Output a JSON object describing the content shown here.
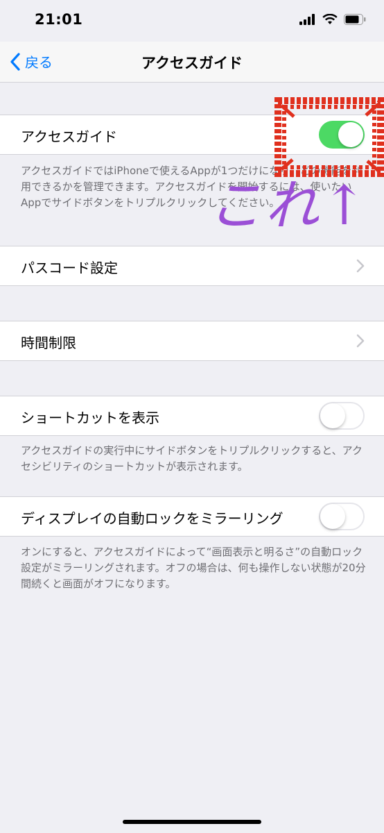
{
  "status_bar": {
    "time": "21:01"
  },
  "nav": {
    "back_label": "戻る",
    "title": "アクセスガイド"
  },
  "guided_access": {
    "label": "アクセスガイド",
    "toggle_on": true,
    "footer": "アクセスガイドではiPhoneで使えるAppが1つだけになり、どの機能を利用できるかを管理できます。アクセスガイドを開始するには、使いたいAppでサイドボタンをトリプルクリックしてください。"
  },
  "passcode": {
    "label": "パスコード設定"
  },
  "time_limits": {
    "label": "時間制限"
  },
  "shortcut": {
    "label": "ショートカットを表示",
    "toggle_on": false,
    "footer": "アクセスガイドの実行中にサイドボタンをトリプルクリックすると、アクセシビリティのショートカットが表示されます。"
  },
  "mirror_lock": {
    "label": "ディスプレイの自動ロックをミラーリング",
    "toggle_on": false,
    "footer": "オンにすると、アクセスガイドによって“画面表示と明るさ”の自動ロック設定がミラーリングされます。オフの場合は、何も操作しない状態が20分間続くと画面がオフになります。"
  },
  "annotation": {
    "text": "これ↑"
  },
  "colors": {
    "accent": "#007aff",
    "toggle_on": "#4cd964",
    "highlight": "#e0301e",
    "annotation": "#9b4fd6"
  }
}
